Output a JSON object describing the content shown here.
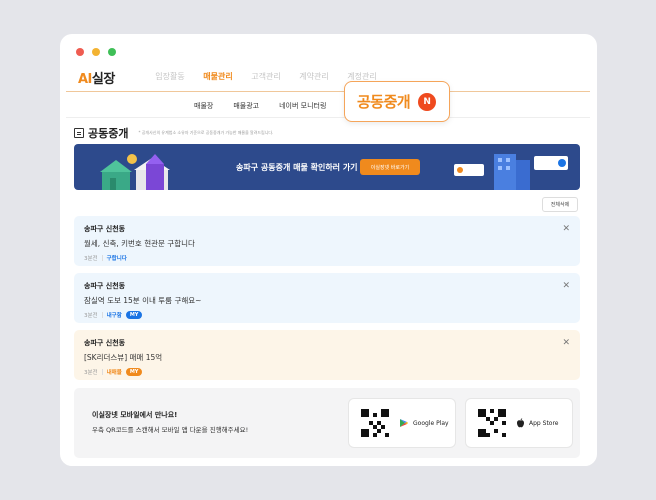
{
  "app": {
    "logo_ai": "AI",
    "logo_rest": "실장"
  },
  "topmenu": [
    {
      "label": "임장활동",
      "active": false
    },
    {
      "label": "매물관리",
      "active": true
    },
    {
      "label": "고객관리",
      "active": false
    },
    {
      "label": "계약관리",
      "active": false
    },
    {
      "label": "계정관리",
      "active": false
    }
  ],
  "submenu": [
    {
      "label": "매물장"
    },
    {
      "label": "매물광고"
    },
    {
      "label": "네이버 모니터링"
    }
  ],
  "popup": {
    "label": "공동중개",
    "badge": "N"
  },
  "page": {
    "title": "공동중개",
    "notice": "* 공개사신의 유계법소 소유자 기준으로 공동중개가 가능한 매물을 알려드립니다."
  },
  "banner": {
    "text": "송파구 공동중개 매물 확인하러 가기",
    "cta": "이실장넷 바로가기",
    "color": "#2d4a8c"
  },
  "delete_all": "전체삭제",
  "cards": [
    {
      "region": "송파구 신천동",
      "message": "월세, 신축, 키번호 현관문 구합니다",
      "time": "3분전",
      "kind": "구합니다",
      "my": "",
      "theme": "blue"
    },
    {
      "region": "송파구 신천동",
      "message": "잠실역 도보 15분 이내 투룸 구해요~",
      "time": "3분전",
      "kind": "내구함",
      "my": "MY",
      "theme": "blue"
    },
    {
      "region": "송파구 신천동",
      "message": "[SK리더스뷰] 매매 15억",
      "time": "3분전",
      "kind": "내매물",
      "my": "MY",
      "theme": "orange"
    }
  ],
  "mobile": {
    "heading": "이실장넷 모바일에서 만나요!",
    "sub": "우측 QR코드를 스캔해서 모바일 앱 다운을 진행해주세요!",
    "google_play": "Google Play",
    "app_store": "App Store"
  },
  "colors": {
    "accent": "#f08a1d",
    "badge_red": "#ef4a1f",
    "link_blue": "#1b74e4"
  }
}
